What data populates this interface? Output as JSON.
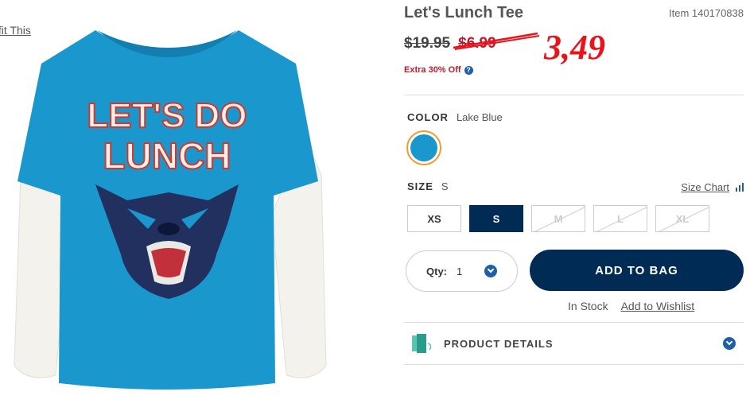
{
  "outfit_link": "tfit This",
  "product": {
    "title": "Let's Lunch Tee",
    "item_number": "Item 140170838",
    "original_price": "$19.95",
    "sale_price": "$6.99",
    "handwritten_price": "3,49",
    "promo": "Extra 30% Off",
    "shirt_text_line1": "LET'S DO",
    "shirt_text_line2": "LUNCH"
  },
  "color": {
    "label": "COLOR",
    "value": "Lake Blue",
    "swatch_color": "#1a97cc"
  },
  "size": {
    "label": "SIZE",
    "value": "S",
    "chart_link": "Size Chart",
    "options": [
      {
        "label": "XS",
        "state": "available"
      },
      {
        "label": "S",
        "state": "selected"
      },
      {
        "label": "M",
        "state": "unavailable"
      },
      {
        "label": "L",
        "state": "unavailable"
      },
      {
        "label": "XL",
        "state": "unavailable"
      }
    ]
  },
  "quantity": {
    "label": "Qty:",
    "value": "1"
  },
  "add_to_bag": "ADD TO BAG",
  "stock_status": "In Stock",
  "wishlist_link": "Add to Wishlist",
  "product_details": "PRODUCT DETAILS",
  "colors": {
    "navy": "#002b55",
    "sale_red": "#c0182e",
    "shirt_blue": "#1a97cc",
    "swatch_ring": "#f29b2c"
  }
}
